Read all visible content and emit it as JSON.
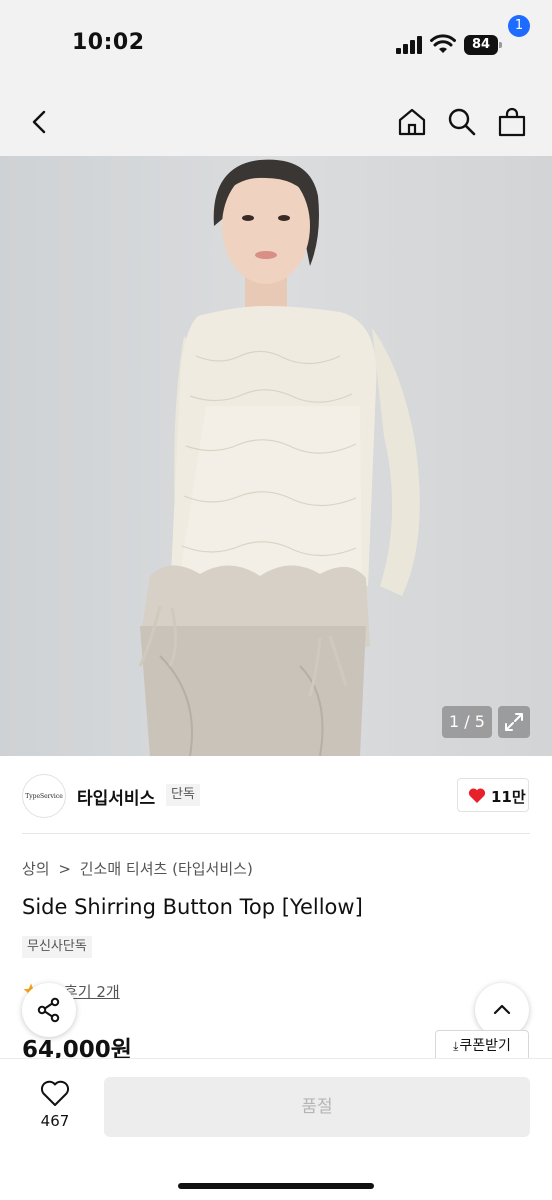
{
  "status_bar": {
    "time": "10:02",
    "battery": "84"
  },
  "nav": {
    "cart_badge": "1"
  },
  "hero": {
    "counter": "1 / 5"
  },
  "brand": {
    "logo_text": "TypeService",
    "name": "타입서비스",
    "tag": "단독",
    "like_count": "11만",
    "like_color": "#e8202a"
  },
  "breadcrumb": {
    "items": [
      "상의",
      ">",
      "긴소매 티셔츠 (타입서비스)"
    ]
  },
  "product": {
    "title": "Side Shirring Button Top [Yellow]",
    "exclusive_tag": "무신사단독",
    "review_text": "후기 2개",
    "price": "64,000원"
  },
  "actions": {
    "coupon_label": "쿠폰받기",
    "wish_count": "467",
    "soldout_label": "품절"
  },
  "colors": {
    "accent_blue": "#1e6bff",
    "star": "#f5a623"
  }
}
